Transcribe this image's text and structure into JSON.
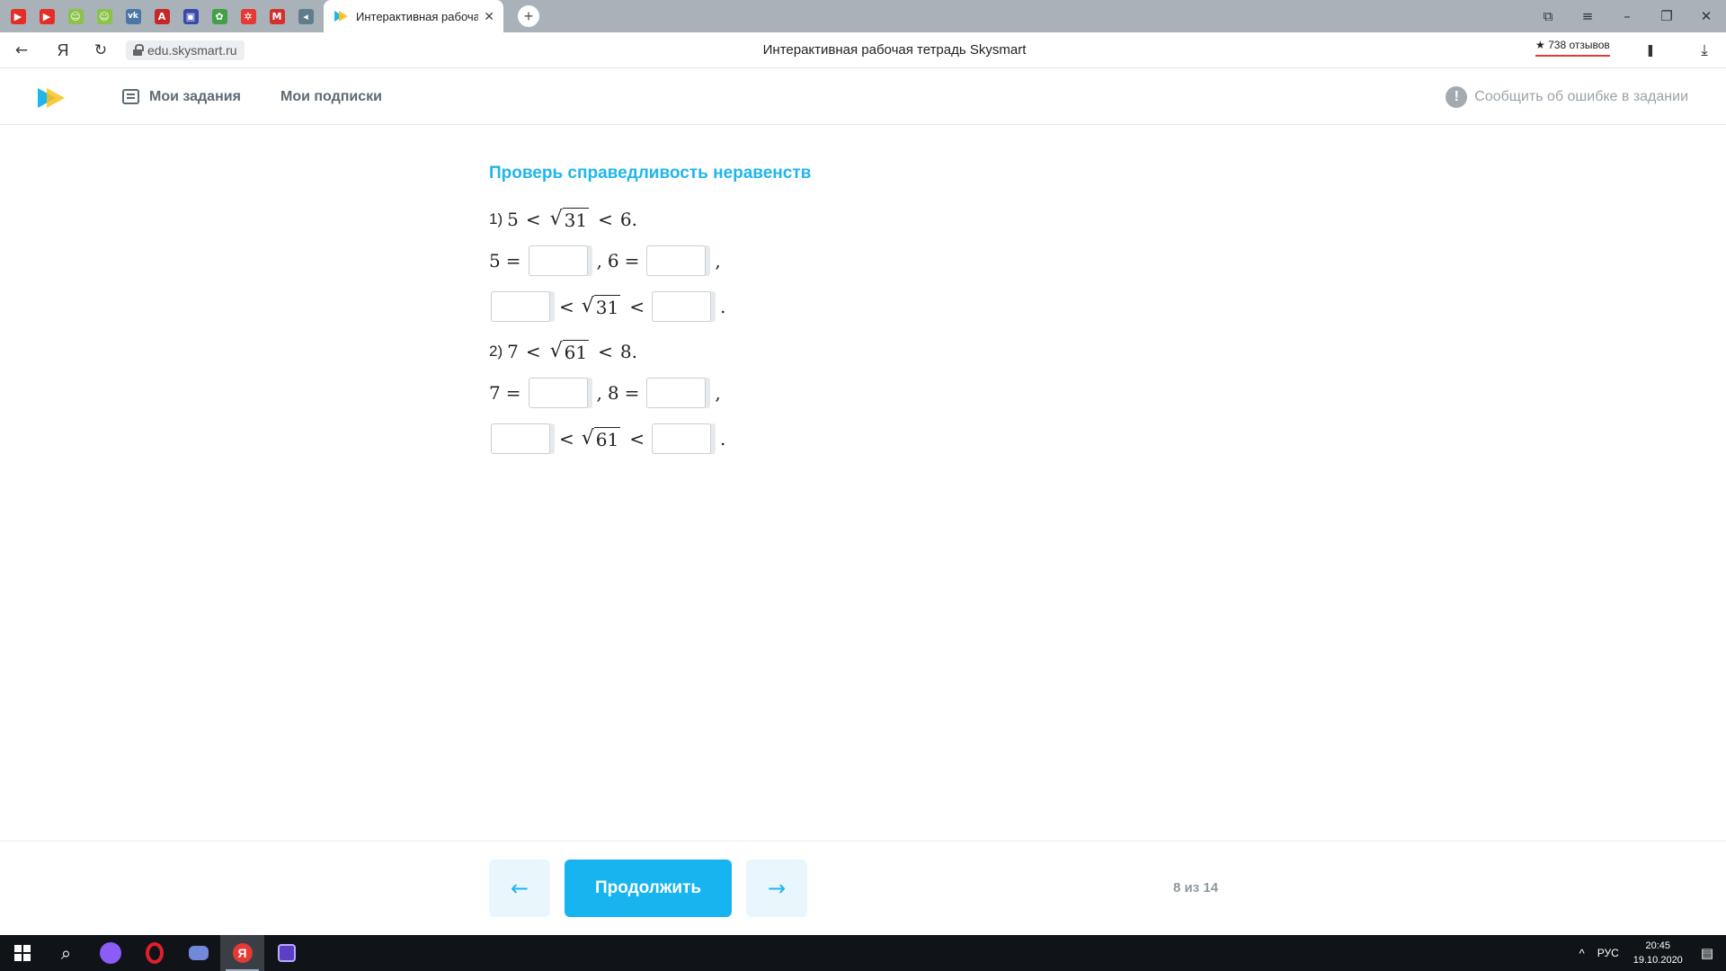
{
  "browser": {
    "pinned_tabs": [
      {
        "icon": "youtube-icon",
        "glyph": "▶",
        "color": "#e52d27"
      },
      {
        "icon": "youtube-icon",
        "glyph": "▶",
        "color": "#e52d27"
      },
      {
        "icon": "mascot-icon",
        "glyph": "☺",
        "color": "#8bc34a"
      },
      {
        "icon": "mascot-icon",
        "glyph": "☺",
        "color": "#8bc34a"
      },
      {
        "icon": "vk-icon",
        "glyph": "vk",
        "color": "#4a76a8"
      },
      {
        "icon": "letter-a-icon",
        "glyph": "A",
        "color": "#c62828"
      },
      {
        "icon": "image-icon",
        "glyph": "▣",
        "color": "#3949ab"
      },
      {
        "icon": "plant-icon",
        "glyph": "✿",
        "color": "#43a047"
      },
      {
        "icon": "gear-icon",
        "glyph": "✲",
        "color": "#e53935"
      },
      {
        "icon": "letter-m-icon",
        "glyph": "M",
        "color": "#d32f2f"
      },
      {
        "icon": "speaker-icon",
        "glyph": "◂",
        "color": "#607d8b"
      }
    ],
    "active_tab_title": "Интерактивная рабоча",
    "close_glyph": "✕",
    "newtab_glyph": "+",
    "window_controls": [
      "⧉",
      "≡",
      "–",
      "❐",
      "✕"
    ],
    "url": "edu.skysmart.ru",
    "page_title": "Интерактивная рабочая тетрадь Skysmart",
    "reviews_star": "★",
    "reviews": "738 отзывов",
    "nav": {
      "back": "←",
      "yandex": "Я",
      "reload": "↻",
      "bookmark": "❚",
      "download": "⤓"
    }
  },
  "header": {
    "my_tasks": "Мои задания",
    "my_subscriptions": "Мои подписки",
    "report_icon": "!",
    "report_error": "Сообщить об ошибке в задании"
  },
  "task": {
    "title": "Проверь справедливость неравенств",
    "lt": "<",
    "eq": "=",
    "comma": ",",
    "period": ".",
    "sqrt_sign": "√",
    "p1": {
      "num": "1)",
      "a": "5",
      "radicand": "31",
      "b": "6"
    },
    "p2": {
      "num": "2)",
      "a": "7",
      "radicand": "61",
      "b": "8"
    }
  },
  "footer": {
    "prev_glyph": "←",
    "continue": "Продолжить",
    "next_glyph": "→",
    "progress": "8 из 14"
  },
  "taskbar": {
    "search_glyph": "⌕",
    "tray_up": "^",
    "lang": "РУС",
    "time": "20:45",
    "date": "19.10.2020",
    "notif_glyph": "▤"
  }
}
